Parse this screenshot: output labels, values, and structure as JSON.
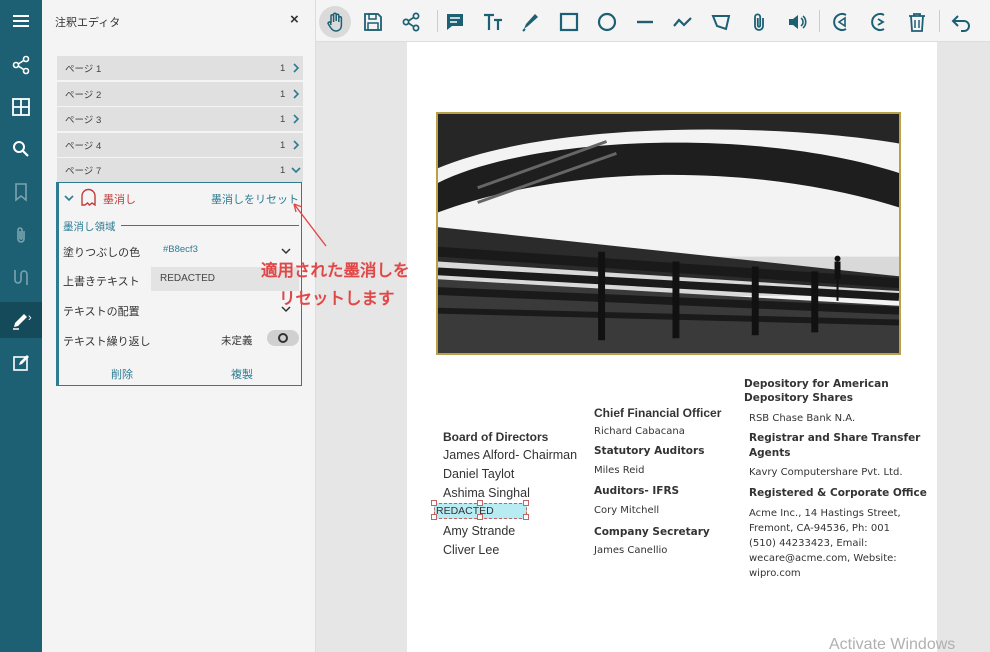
{
  "panel": {
    "title": "注釈エディタ",
    "close": "×",
    "pages": [
      {
        "label": "ページ 1",
        "count": "1"
      },
      {
        "label": "ページ 2",
        "count": "1"
      },
      {
        "label": "ページ 3",
        "count": "1"
      },
      {
        "label": "ページ 4",
        "count": "1"
      },
      {
        "label": "ページ 7",
        "count": "1"
      }
    ],
    "redaction": {
      "label": "墨消し",
      "reset": "墨消しをリセット",
      "section": "墨消し領域",
      "fill_color_label": "塗りつぶしの色",
      "fill_color_value": "#B8ecf3",
      "overlay_text_label": "上書きテキスト",
      "overlay_text_value": "REDACTED",
      "text_align_label": "テキストの配置",
      "text_wrap_label": "テキスト繰り返し",
      "text_wrap_value": "未定義",
      "delete": "削除",
      "duplicate": "複製"
    }
  },
  "callout": {
    "line1": "適用された墨消しを",
    "line2": "リセットします"
  },
  "document": {
    "board": {
      "heading": "Board of Directors",
      "names": [
        "James Alford- Chairman",
        "Daniel Taylot",
        "Ashima Singhal",
        "Amy Strande",
        "Cliver Lee"
      ],
      "redacted": "REDACTED"
    },
    "cfo": {
      "heading": "Chief Financial Officer",
      "name": "Richard Cabacana",
      "auditors_heading": "Statutory Auditors",
      "auditors": "Miles Reid",
      "ifrs_heading": "Auditors- IFRS",
      "ifrs": "Cory Mitchell",
      "secretary_heading": "Company Secretary",
      "secretary": "James Canellio"
    },
    "depository": {
      "heading_l1": "Depository for American",
      "heading_l2": "Depository Shares",
      "bank": "RSB Chase Bank N.A.",
      "registrar_heading_l1": "Registrar and Share Transfer",
      "registrar_heading_l2": "Agents",
      "registrar": "Kavry Computershare Pvt. Ltd.",
      "office_heading": "Registered & Corporate Office",
      "address": [
        "Acme Inc., 14 Hastings Street,",
        "Fremont, CA-94536, Ph: 001",
        "(510) 44233423, Email:",
        "wecare@acme.com, Website:",
        "wipro.com"
      ]
    }
  },
  "watermark": "Activate Windows",
  "colors": {
    "rail": "#1d5f73",
    "accent": "#2e7b92",
    "redaction_fill": "#b8ecf3",
    "callout": "#e04848"
  }
}
